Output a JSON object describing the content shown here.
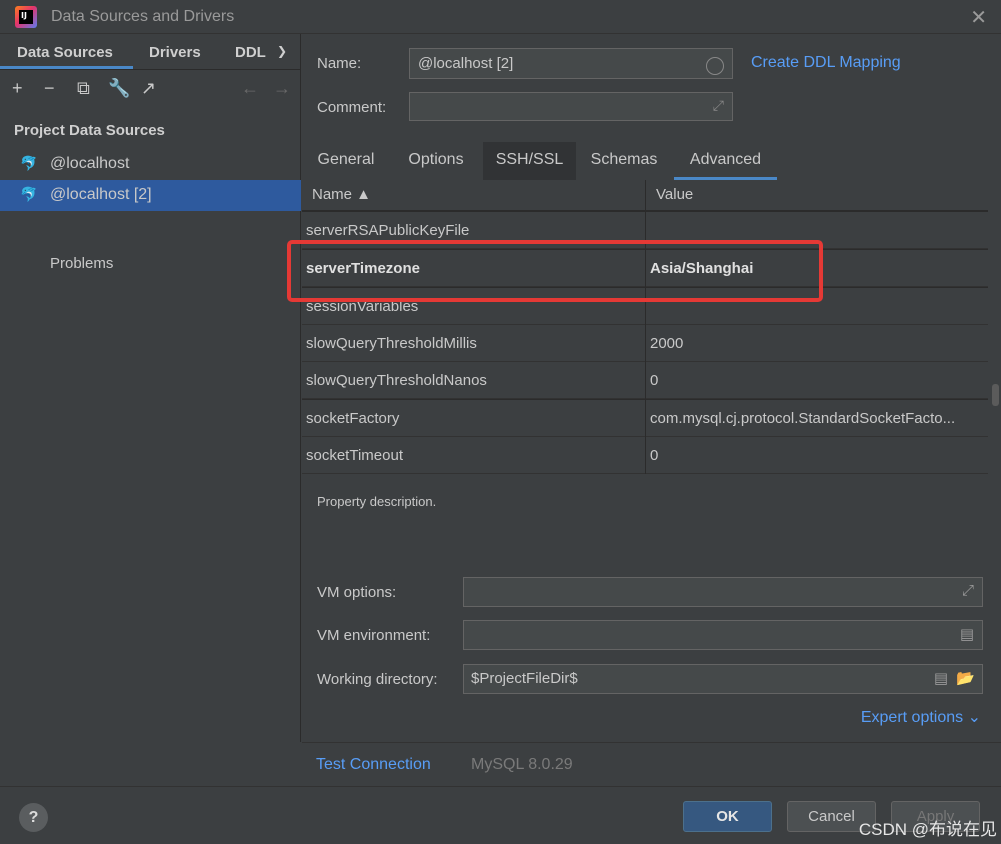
{
  "window": {
    "title": "Data Sources and Drivers"
  },
  "left": {
    "tabs": [
      "Data Sources",
      "Drivers",
      "DDL"
    ],
    "section_title": "Project Data Sources",
    "items": [
      {
        "label": "@localhost",
        "selected": false
      },
      {
        "label": "@localhost [2]",
        "selected": true
      }
    ],
    "problems_label": "Problems"
  },
  "form": {
    "name_label": "Name:",
    "name_value": "@localhost [2]",
    "comment_label": "Comment:",
    "comment_value": "",
    "create_ddl_link": "Create DDL Mapping"
  },
  "tabs": [
    "General",
    "Options",
    "SSH/SSL",
    "Schemas",
    "Advanced"
  ],
  "active_tab": "Advanced",
  "grid": {
    "columns": [
      "Name ▲",
      "Value"
    ],
    "rows": [
      {
        "name": "serverRSAPublicKeyFile",
        "value": "",
        "bold": false
      },
      {
        "name": "serverTimezone",
        "value": "Asia/Shanghai",
        "bold": true
      },
      {
        "name": "sessionVariables",
        "value": "",
        "bold": false
      },
      {
        "name": "slowQueryThresholdMillis",
        "value": "2000",
        "bold": false
      },
      {
        "name": "slowQueryThresholdNanos",
        "value": "0",
        "bold": false
      },
      {
        "name": "socketFactory",
        "value": "com.mysql.cj.protocol.StandardSocketFacto...",
        "bold": false
      },
      {
        "name": "socketTimeout",
        "value": "0",
        "bold": false
      }
    ]
  },
  "description": "Property description.",
  "vm": {
    "options_label": "VM options:",
    "options_value": "",
    "environment_label": "VM environment:",
    "environment_value": "",
    "workdir_label": "Working directory:",
    "workdir_value": "$ProjectFileDir$"
  },
  "expert_options": "Expert options",
  "test_connection": "Test Connection",
  "driver_version": "MySQL 8.0.29",
  "buttons": {
    "ok": "OK",
    "cancel": "Cancel",
    "apply": "Apply"
  },
  "watermark": "CSDN @布说在见",
  "colors": {
    "accent": "#4a88c7",
    "link": "#589df6",
    "highlight": "#e53935",
    "selection": "#2e5a9e"
  }
}
